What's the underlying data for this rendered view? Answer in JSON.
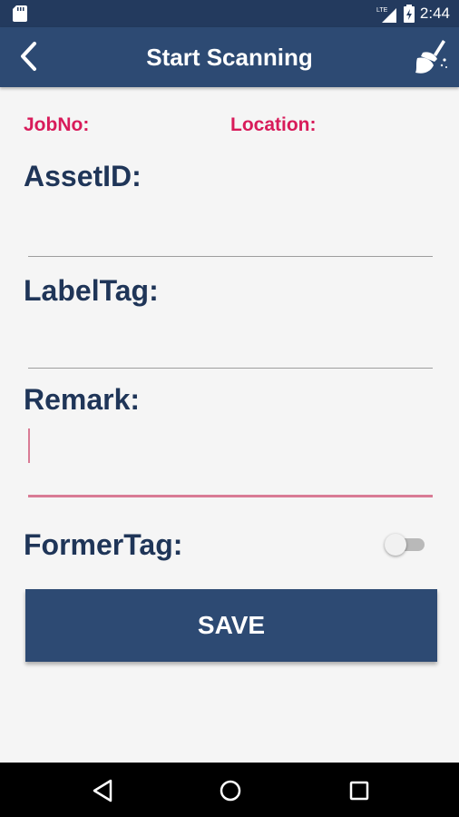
{
  "status_bar": {
    "time": "2:44",
    "network": "LTE",
    "icons": [
      "sd-card-icon",
      "signal-icon",
      "battery-icon"
    ]
  },
  "app_bar": {
    "title": "Start Scanning",
    "back_icon": "chevron-left-icon",
    "action_icon": "broom-icon"
  },
  "form": {
    "jobno_label": "JobNo:",
    "location_label": "Location:",
    "assetid_label": "AssetID:",
    "assetid_value": "",
    "labeltag_label": "LabelTag:",
    "labeltag_value": "",
    "remark_label": "Remark:",
    "remark_value": "",
    "formertag_label": "FormerTag:",
    "formertag_enabled": false,
    "save_label": "SAVE"
  },
  "colors": {
    "status_bar": "#233a5e",
    "app_bar": "#2d4a73",
    "accent_red": "#d81b5a",
    "label_navy": "#1f3558",
    "focus_underline": "#d97b95"
  },
  "nav_bar": {
    "icons": [
      "back-triangle-icon",
      "home-circle-icon",
      "recents-square-icon"
    ]
  }
}
